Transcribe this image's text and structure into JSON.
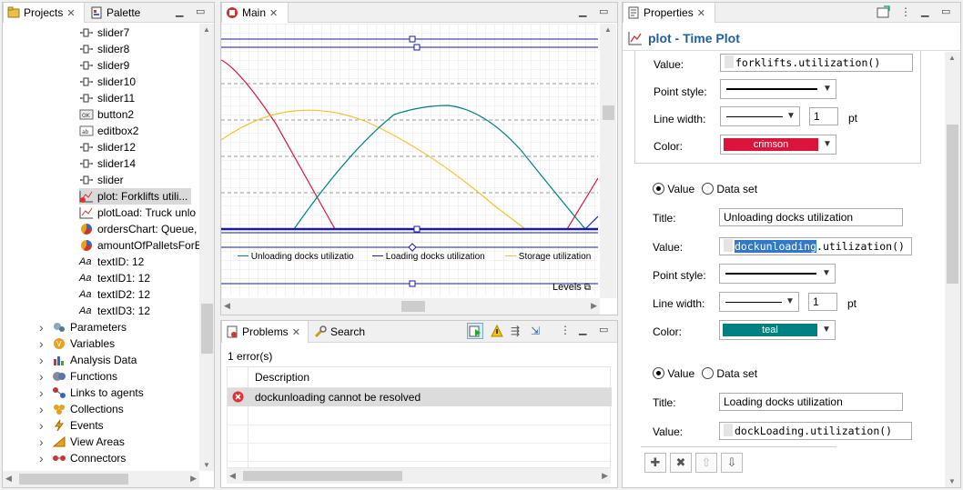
{
  "projects": {
    "tabs": [
      {
        "label": "Projects"
      },
      {
        "label": "Palette"
      }
    ],
    "items": [
      {
        "label": "slider7",
        "type": "slider"
      },
      {
        "label": "slider8",
        "type": "slider"
      },
      {
        "label": "slider9",
        "type": "slider"
      },
      {
        "label": "slider10",
        "type": "slider"
      },
      {
        "label": "slider11",
        "type": "slider"
      },
      {
        "label": "button2",
        "type": "button"
      },
      {
        "label": "editbox2",
        "type": "editbox"
      },
      {
        "label": "slider12",
        "type": "slider"
      },
      {
        "label": "slider14",
        "type": "slider"
      },
      {
        "label": "slider",
        "type": "slider"
      },
      {
        "label": "plot: Forklifts utili...",
        "type": "plot-error",
        "selected": true
      },
      {
        "label": "plotLoad: Truck unlo",
        "type": "plot"
      },
      {
        "label": "ordersChart: Queue,",
        "type": "pie"
      },
      {
        "label": "amountOfPalletsForE",
        "type": "pie"
      },
      {
        "label": "textID: 12",
        "type": "text"
      },
      {
        "label": "textID1: 12",
        "type": "text"
      },
      {
        "label": "textID2: 12",
        "type": "text"
      },
      {
        "label": "textID3: 12",
        "type": "text"
      }
    ],
    "groups": [
      {
        "label": "Parameters"
      },
      {
        "label": "Variables"
      },
      {
        "label": "Analysis Data"
      },
      {
        "label": "Functions"
      },
      {
        "label": "Links to agents"
      },
      {
        "label": "Collections"
      },
      {
        "label": "Events"
      },
      {
        "label": "View Areas"
      },
      {
        "label": "Connectors"
      }
    ],
    "text_glyph": "Aa"
  },
  "main": {
    "tab_label": "Main",
    "legend": [
      {
        "label": "Unloading docks utilizatio",
        "color": "#008080"
      },
      {
        "label": "Loading docks utilization",
        "color": "#2020c0"
      },
      {
        "label": "Storage utilization",
        "color": "#f2c230"
      }
    ],
    "levels_label": "Levels"
  },
  "problems": {
    "tabs": [
      {
        "label": "Problems"
      },
      {
        "label": "Search"
      }
    ],
    "summary": "1 error(s)",
    "column": "Description",
    "rows": [
      {
        "text": "dockunloading cannot be resolved"
      }
    ]
  },
  "properties": {
    "tab_label": "Properties",
    "title": "plot - Time Plot",
    "series1": {
      "value_label": "Value:",
      "value": "forklifts.utilization()",
      "point_style_label": "Point style:",
      "line_width_label": "Line width:",
      "line_width": "1",
      "unit": "pt",
      "color_label": "Color:",
      "color_name": "crimson",
      "color": "#dc143c"
    },
    "series2": {
      "radio_value": "Value",
      "radio_dataset": "Data set",
      "title_label": "Title:",
      "title": "Unloading docks utilization",
      "value_label": "Value:",
      "value_highlight": "dockunloading",
      "value_rest": ".utilization()",
      "point_style_label": "Point style:",
      "line_width_label": "Line width:",
      "line_width": "1",
      "unit": "pt",
      "color_label": "Color:",
      "color_name": "teal",
      "color": "#008080"
    },
    "series3": {
      "radio_value": "Value",
      "radio_dataset": "Data set",
      "title_label": "Title:",
      "title": "Loading docks utilization",
      "value_label": "Value:",
      "value": "dockLoading.utilization()"
    }
  }
}
